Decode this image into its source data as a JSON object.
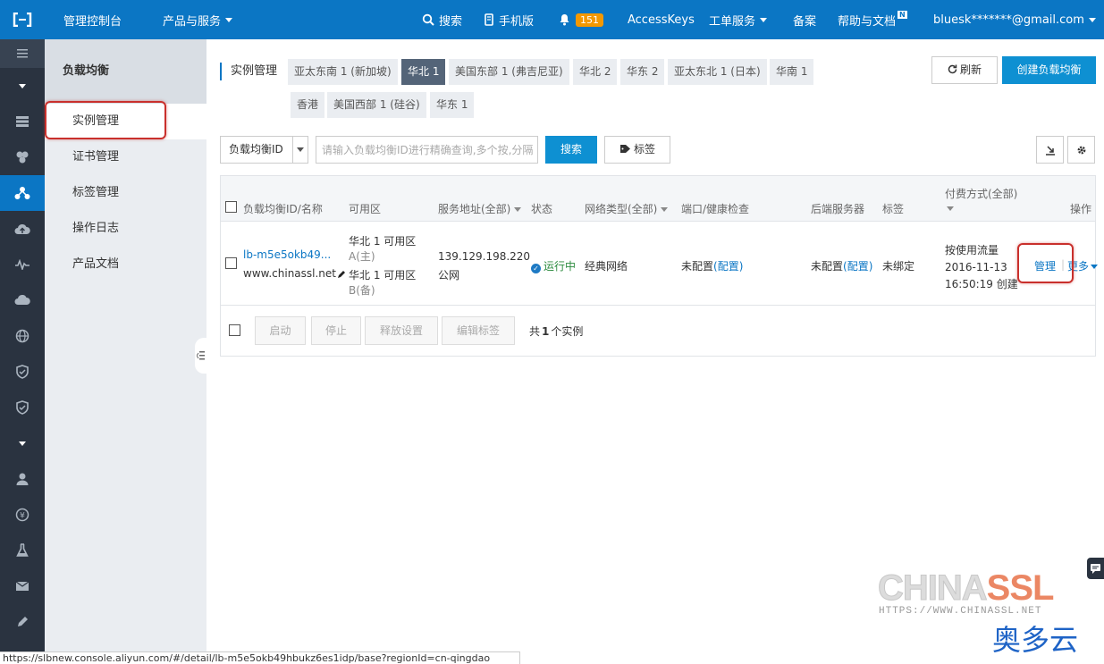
{
  "topbar": {
    "console": "管理控制台",
    "products": "产品与服务",
    "search": "搜索",
    "mobile": "手机版",
    "notifications": "151",
    "accesskeys": "AccessKeys",
    "tickets": "工单服务",
    "beian": "备案",
    "help": "帮助与文档",
    "help_badge": "N",
    "user": "bluesk*******@gmail.com"
  },
  "sidebar": {
    "title": "负载均衡",
    "items": [
      "实例管理",
      "证书管理",
      "标签管理",
      "操作日志",
      "产品文档"
    ]
  },
  "regions": {
    "label": "实例管理",
    "tabs": [
      "亚太东南 1 (新加坡)",
      "华北 1",
      "美国东部 1 (弗吉尼亚)",
      "华北 2",
      "华东 2",
      "亚太东北 1 (日本)",
      "华南 1",
      "香港",
      "美国西部 1 (硅谷)",
      "华东 1"
    ],
    "active": "华北 1"
  },
  "actions": {
    "refresh": "刷新",
    "create": "创建负载均衡"
  },
  "filter": {
    "select_value": "负载均衡ID",
    "placeholder": "请输入负载均衡ID进行精确查询,多个按,分隔",
    "search_button": "搜索",
    "tag_button": "标签"
  },
  "table": {
    "headers": {
      "id": "负载均衡ID/名称",
      "zone": "可用区",
      "address": "服务地址(全部)",
      "status": "状态",
      "network": "网络类型(全部)",
      "port": "端口/健康检查",
      "backend": "后端服务器",
      "tag": "标签",
      "billing": "付费方式(全部)",
      "ops": "操作"
    },
    "row": {
      "id": "lb-m5e5okb49...",
      "name": "www.chinassl.net",
      "zone_primary": "华北 1 可用区",
      "zone_primary_suffix": "A(主)",
      "zone_backup": "华北 1 可用区",
      "zone_backup_suffix": "B(备)",
      "ip": "139.129.198.220",
      "ip_type": "公网",
      "status": "运行中",
      "network": "经典网络",
      "port": "未配置",
      "port_link": "(配置)",
      "backend": "未配置",
      "backend_link": "(配置)",
      "tag": "未绑定",
      "billing": "按使用流量",
      "created_date": "2016-11-13",
      "created_time": "16:50:19 创建",
      "manage": "管理",
      "more": "更多"
    },
    "footer": {
      "start": "启动",
      "stop": "停止",
      "release": "释放设置",
      "edit_tags": "编辑标签",
      "count_prefix": "共",
      "count": "1",
      "count_suffix": "个实例"
    }
  },
  "statusbar": "https://slbnew.console.aliyun.com/#/detail/lb-m5e5okb49hbukz6es1idp/base?regionId=cn-qingdao",
  "watermark": {
    "brand_a": "CHINA",
    "brand_b": "SSL",
    "url": "HTTPS://WWW.CHINASSL.NET",
    "cn": "奥多云"
  }
}
